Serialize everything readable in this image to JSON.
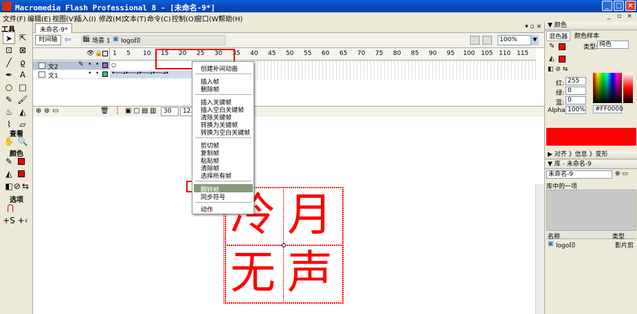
{
  "window": {
    "title": "Macromedia Flash Professional 8 - [未命名-9*]",
    "controls": {
      "minimize": "_",
      "maximize": "□",
      "close": "×"
    }
  },
  "menubar": {
    "items": [
      "文件(F)",
      "编辑(E)",
      "视图(V)",
      "插入(I)",
      "修改(M)",
      "文本(T)",
      "命令(C)",
      "控制(O)",
      "窗口(W)",
      "帮助(H)"
    ]
  },
  "tools": {
    "header": "工具",
    "view_label": "查看",
    "colors_label": "颜色",
    "options_label": "选项"
  },
  "document": {
    "tab": "未命名-9*",
    "timeline_toggle": "时间轴",
    "breadcrumb_scene": "场景 1",
    "breadcrumb_symbol": "logo印",
    "zoom": "100%"
  },
  "timeline": {
    "ruler": [
      "1",
      "5",
      "10",
      "15",
      "20",
      "25",
      "30",
      "35",
      "40",
      "45",
      "50",
      "55",
      "60",
      "65",
      "70",
      "75",
      "80",
      "85",
      "90",
      "95",
      "100",
      "105",
      "110",
      "115"
    ],
    "layers": [
      {
        "name": "文2",
        "selected": true
      },
      {
        "name": "文1",
        "selected": false
      }
    ],
    "current_frame": "30",
    "fps": "12.",
    "stage_chars": [
      "冷",
      "月",
      "无",
      "声"
    ]
  },
  "context_menu": {
    "items_group1": [
      "创建补间动画"
    ],
    "items_group2": [
      "插入帧",
      "删除帧"
    ],
    "items_group3": [
      "插入关键帧",
      "插入空白关键帧",
      "清除关键帧",
      "转换为关键帧",
      "转换为空白关键帧"
    ],
    "items_group4": [
      "剪切帧",
      "复制帧",
      "粘贴帧",
      "清除帧",
      "选择所有帧"
    ],
    "items_group5": [
      "翻转帧",
      "同步符号"
    ],
    "items_group6": [
      "动作"
    ]
  },
  "right_panel": {
    "color_panel_title": "颜色",
    "tab_mixer": "混色器",
    "tab_swatches": "颜色样本",
    "type_label": "类型:",
    "type_value": "纯色",
    "red_label": "红:",
    "red_value": "255",
    "green_label": "绿:",
    "green_value": "0",
    "blue_label": "蓝:",
    "blue_value": "0",
    "alpha_label": "Alpha:",
    "alpha_value": "100%",
    "hex_value": "#FF0000",
    "align_panel_title": "对齐 》信息 》变形",
    "library_panel_title": "库 - 未命名-9",
    "library_select": "未命名-9",
    "library_count": "库中的一项",
    "col_name": "名称",
    "col_type": "类型",
    "item_name": "logo印",
    "item_type": "影片剪"
  },
  "colors": {
    "accent_red": "#ff0000",
    "title_blue": "#0b48b8",
    "menu_highlight": "#8a9a78"
  }
}
